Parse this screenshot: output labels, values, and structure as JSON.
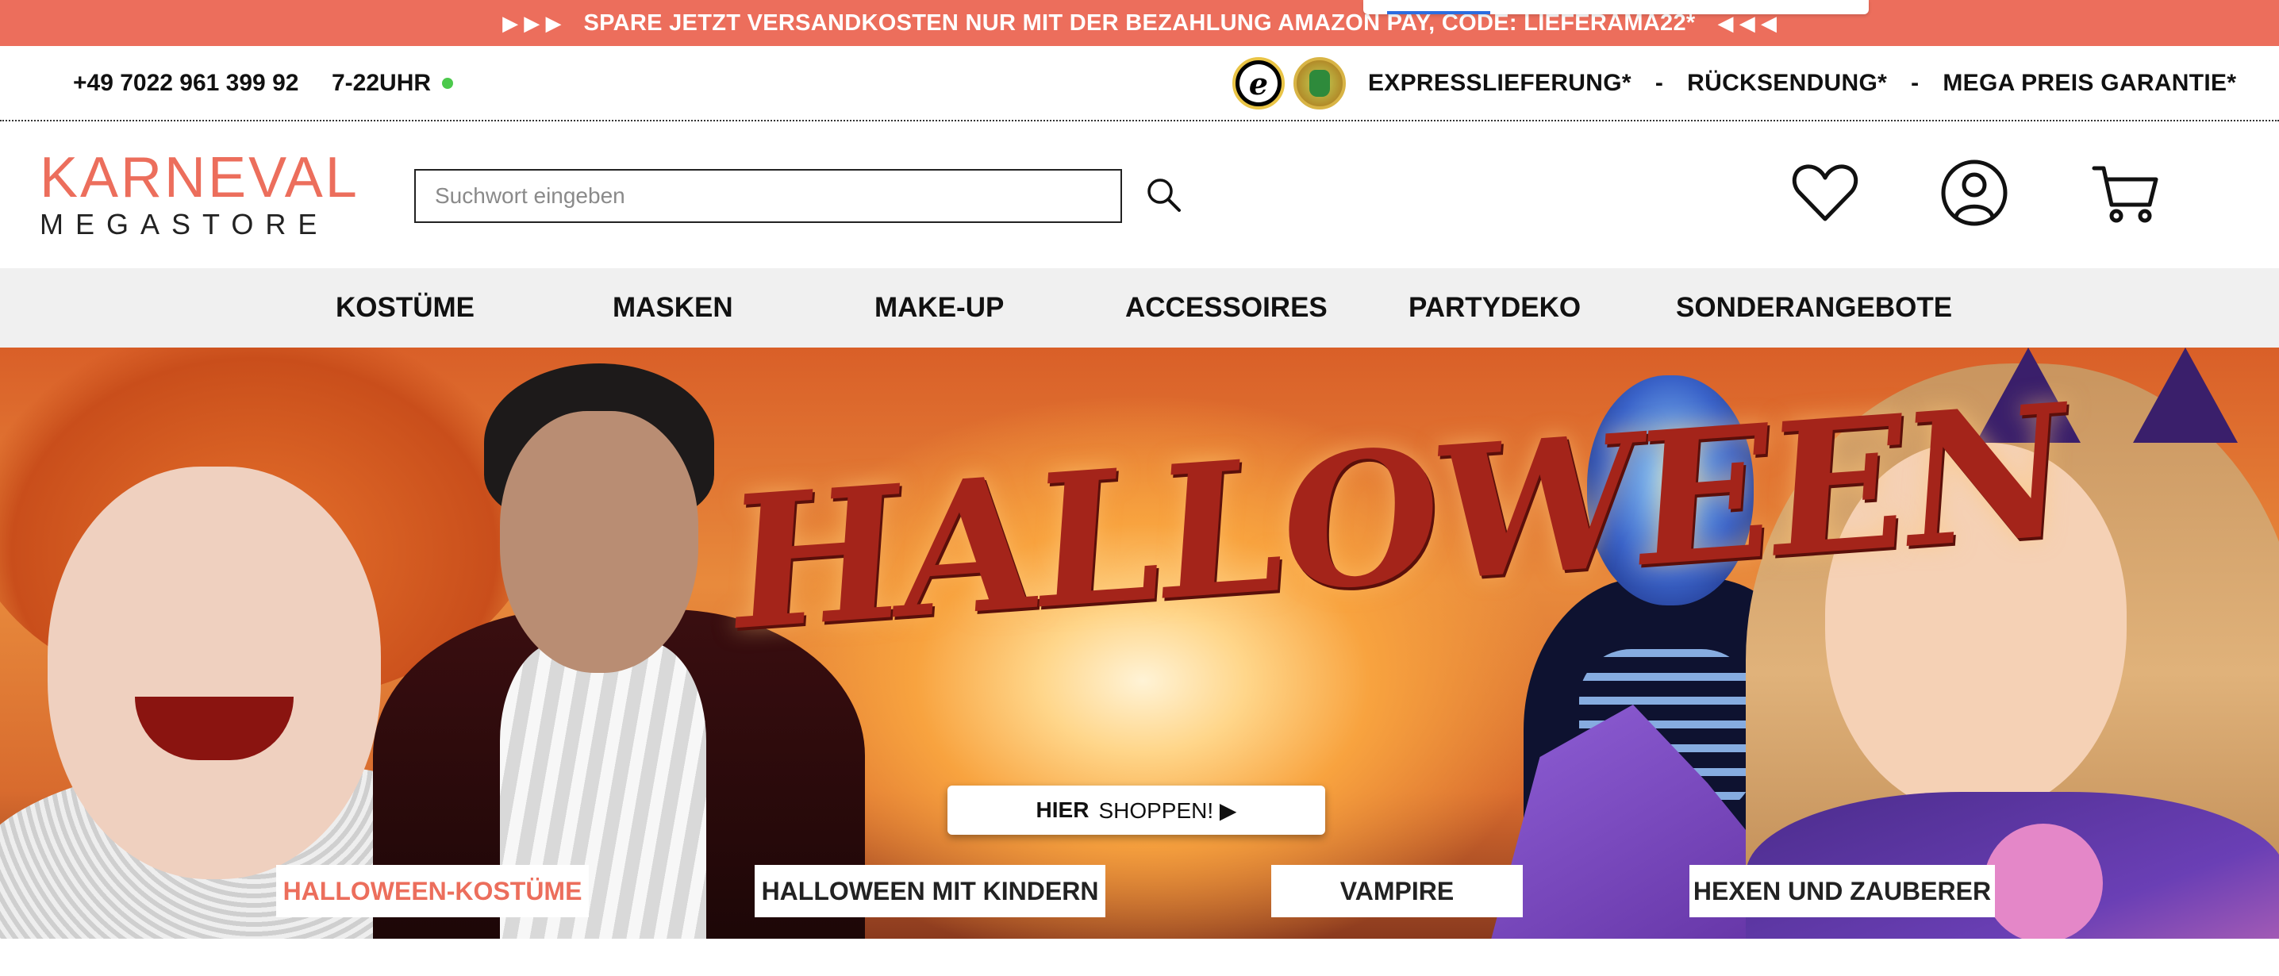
{
  "promo": {
    "arrows_left": "▶ ▶ ▶",
    "message": "SPARE JETZT VERSANDKOSTEN NUR MIT DER BEZAHLUNG AMAZON PAY, CODE: LIEFERAMA22*",
    "arrows_right": "◀ ◀ ◀"
  },
  "infobar": {
    "phone": "+49 7022 961 399 92",
    "hours": "7-22UHR",
    "usp_express": "EXPRESSLIEFERUNG*",
    "sep1": "-",
    "usp_return": "RÜCKSENDUNG*",
    "sep2": "-",
    "usp_price": "MEGA PREIS GARANTIE*",
    "online_color": "#4cc94c"
  },
  "header": {
    "logo_line1": "KARNEVAL",
    "logo_line2": "MEGASTORE",
    "search_placeholder": "Suchwort eingeben",
    "brand_color": "#ec6e5c"
  },
  "nav": {
    "items": [
      "KOSTÜME",
      "MASKEN",
      "MAKE-UP",
      "ACCESSOIRES",
      "PARTYDEKO",
      "SONDERANGEBOTE"
    ]
  },
  "hero": {
    "title": "HALLOWEEN",
    "cta_bold": "HIER",
    "cta_rest": "SHOPPEN! ▶",
    "categories": [
      "HALLOWEEN-KOSTÜME",
      "HALLOWEEN MIT KINDERN",
      "VAMPIRE",
      "HEXEN UND ZAUBERER"
    ]
  }
}
